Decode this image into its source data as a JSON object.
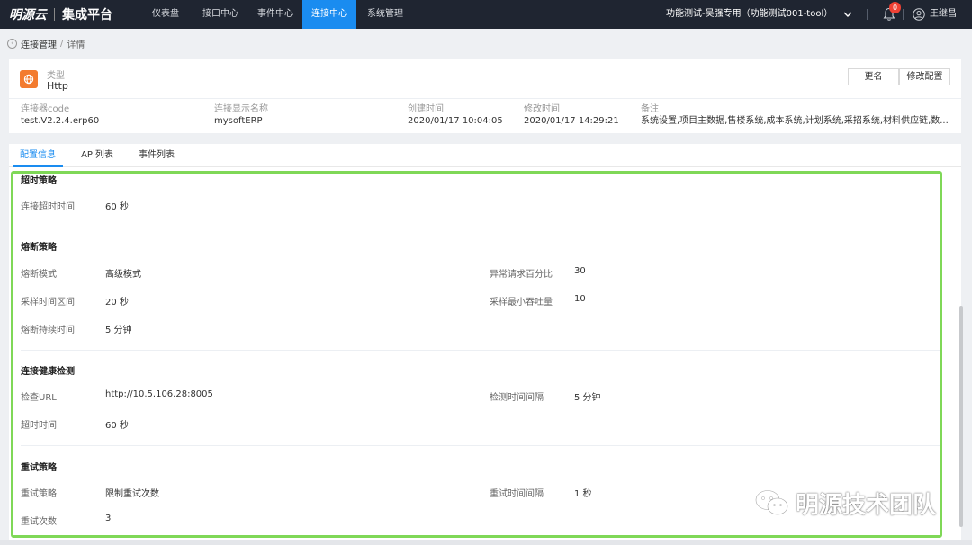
{
  "topbar": {
    "logo_text": "明源云",
    "platform": "集成平台",
    "nav": [
      {
        "label": "仪表盘"
      },
      {
        "label": "接口中心"
      },
      {
        "label": "事件中心"
      },
      {
        "label": "连接中心"
      },
      {
        "label": "系统管理"
      }
    ],
    "active_nav": "连接中心",
    "tenant": "功能测试-吴强专用（功能测试001-tool）",
    "notification_count": "0",
    "user": "王继昌",
    "active_color": "#1a8cf0"
  },
  "breadcrumb": {
    "parent": "连接管理",
    "separator": "/",
    "current": "详情"
  },
  "info": {
    "type_label": "类型",
    "type_value": "Http",
    "rename_button": "更名",
    "edit_button": "修改配置",
    "fields": [
      {
        "label": "连接器code",
        "value": "test.V2.2.4.erp60"
      },
      {
        "label": "连接显示名称",
        "value": "mysoftERP"
      },
      {
        "label": "创建时间",
        "value": "2020/01/17 10:04:05"
      },
      {
        "label": "修改时间",
        "value": "2020/01/17 14:29:21"
      },
      {
        "label": "备注",
        "value": "系统设置,项目主数据,售楼系统,成本系统,计划系统,采招系统,材料供应链,数..."
      }
    ]
  },
  "tabs": [
    {
      "label": "配置信息"
    },
    {
      "label": "API列表"
    },
    {
      "label": "事件列表"
    }
  ],
  "config": {
    "timeout": {
      "title": "超时策略",
      "conn_timeout_label": "连接超时时间",
      "conn_timeout_value": "60 秒"
    },
    "breaker": {
      "title": "熔断策略",
      "mode_label": "熔断模式",
      "mode_value": "高级模式",
      "err_pct_label": "异常请求百分比",
      "err_pct_value": "30",
      "window_label": "采样时间区间",
      "window_value": "20 秒",
      "min_throughput_label": "采样最小吞吐量",
      "min_throughput_value": "10",
      "duration_label": "熔断持续时间",
      "duration_value": "5 分钟"
    },
    "health": {
      "title": "连接健康检测",
      "url_label": "检查URL",
      "url_value": "http://10.5.106.28:8005",
      "interval_label": "检测时间间隔",
      "interval_value": "5 分钟",
      "timeout_label": "超时时间",
      "timeout_value": "60 秒"
    },
    "retry": {
      "title": "重试策略",
      "policy_label": "重试策略",
      "policy_value": "限制重试次数",
      "interval_label": "重试时间间隔",
      "interval_value": "1 秒",
      "count_label": "重试次数",
      "count_value": "3"
    }
  },
  "watermark": "明源技术团队",
  "highlight_color": "#7fd857"
}
